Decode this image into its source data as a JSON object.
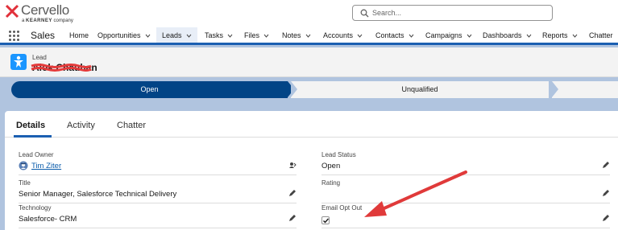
{
  "brand": {
    "name": "Cervello",
    "tagline_prefix": "a",
    "tagline_company": "KEARNEY",
    "tagline_suffix": "company"
  },
  "search": {
    "placeholder": "Search..."
  },
  "nav": {
    "app_name": "Sales",
    "items": [
      {
        "label": "Home",
        "dropdown": false
      },
      {
        "label": "Opportunities",
        "dropdown": true
      },
      {
        "label": "Leads",
        "dropdown": true,
        "active": true
      },
      {
        "label": "Tasks",
        "dropdown": true
      },
      {
        "label": "Files",
        "dropdown": true
      },
      {
        "label": "Notes",
        "dropdown": true
      },
      {
        "label": "Accounts",
        "dropdown": true
      },
      {
        "label": "Contacts",
        "dropdown": true
      },
      {
        "label": "Campaigns",
        "dropdown": true
      },
      {
        "label": "Dashboards",
        "dropdown": true
      },
      {
        "label": "Reports",
        "dropdown": true
      },
      {
        "label": "Chatter",
        "dropdown": false
      }
    ]
  },
  "record": {
    "type": "Lead",
    "name": "Alok Chauhan"
  },
  "path": {
    "steps": [
      "Open",
      "Unqualified"
    ],
    "current": "Open"
  },
  "tabs": [
    "Details",
    "Activity",
    "Chatter"
  ],
  "fields": {
    "lead_owner": {
      "label": "Lead Owner",
      "value": "Tim Ziter"
    },
    "lead_status": {
      "label": "Lead Status",
      "value": "Open"
    },
    "title": {
      "label": "Title",
      "value": "Senior Manager, Salesforce Technical Delivery"
    },
    "rating": {
      "label": "Rating",
      "value": ""
    },
    "technology": {
      "label": "Technology",
      "value": "Salesforce- CRM"
    },
    "email_opt_out": {
      "label": "Email Opt Out",
      "checked": true
    }
  },
  "colors": {
    "brand_blue": "#1b5fb1",
    "path_active": "#014486",
    "annotation_red": "#e03a3a",
    "background": "#b0c4df"
  }
}
